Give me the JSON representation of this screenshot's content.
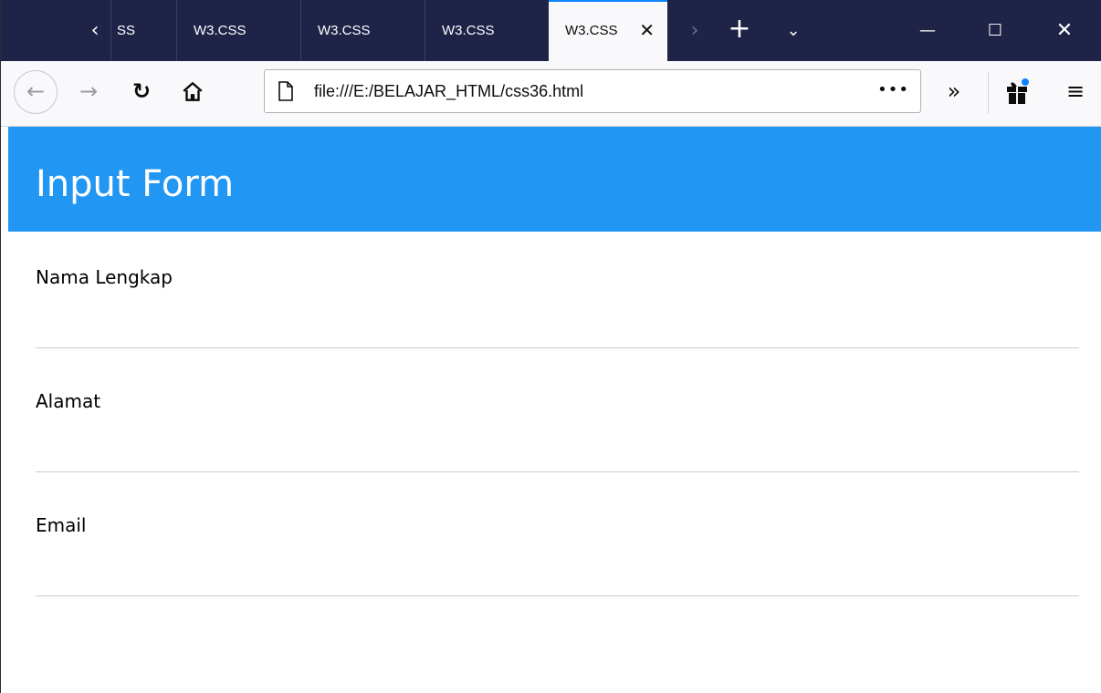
{
  "browser": {
    "tabs": [
      {
        "title": "SS",
        "active": false
      },
      {
        "title": "W3.CSS",
        "active": false
      },
      {
        "title": "W3.CSS",
        "active": false
      },
      {
        "title": "W3.CSS",
        "active": false
      },
      {
        "title": "W3.CSS",
        "active": true
      }
    ],
    "url": "file:///E:/BELAJAR_HTML/css36.html",
    "icons": {
      "tab_scroll_left": "chevron-left-icon",
      "tab_close": "close-icon",
      "tab_scroll_right": "chevron-right-icon",
      "new_tab": "plus-icon",
      "tab_list": "chevron-down-icon",
      "minimize": "minimize-icon",
      "maximize": "maximize-icon",
      "close": "close-icon",
      "back": "arrow-left-icon",
      "forward": "arrow-right-icon",
      "reload": "reload-icon",
      "home": "home-icon",
      "page": "page-icon",
      "page_actions": "more-icon",
      "overflow": "double-chevron-right-icon",
      "whats_new": "gift-icon",
      "menu": "hamburger-menu-icon"
    },
    "colors": {
      "tabbar_bg": "#1f2347",
      "active_tab_bg": "#f9f9fb",
      "active_tab_accent": "#0a84ff"
    }
  },
  "page": {
    "header": {
      "title": "Input Form",
      "color": "#2196f3"
    },
    "form": {
      "fields": [
        {
          "label": "Nama Lengkap",
          "value": ""
        },
        {
          "label": "Alamat",
          "value": ""
        },
        {
          "label": "Email",
          "value": ""
        }
      ]
    }
  }
}
